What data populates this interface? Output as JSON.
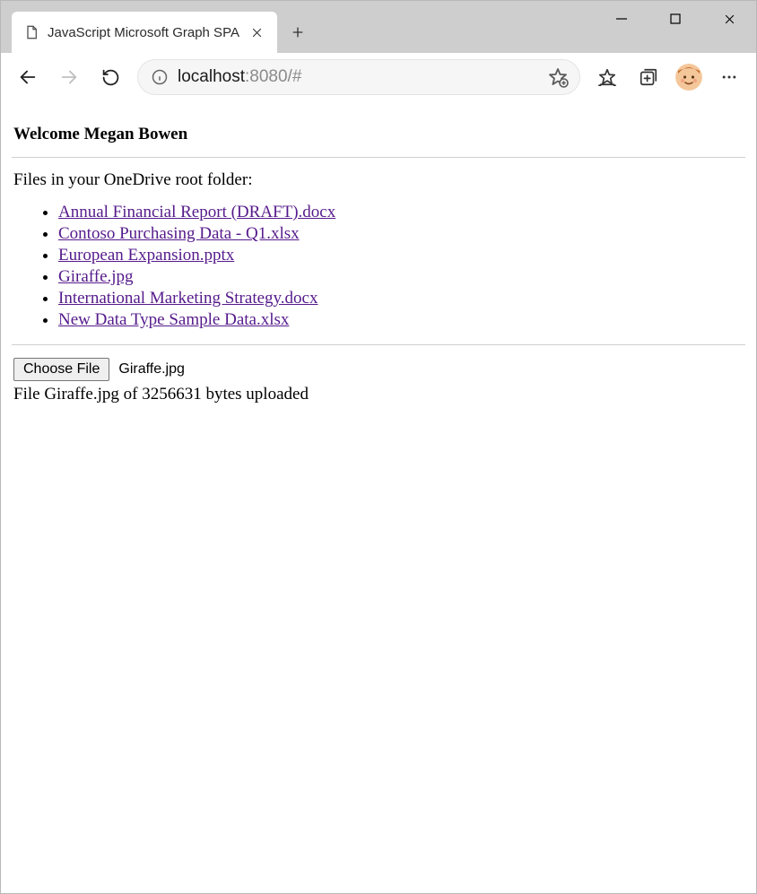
{
  "browser": {
    "tab_title": "JavaScript Microsoft Graph SPA",
    "url_host": "localhost",
    "url_path": ":8080/#"
  },
  "page": {
    "welcome_prefix": "Welcome ",
    "user_name": "Megan Bowen",
    "intro": "Files in your OneDrive root folder:",
    "files": [
      "Annual Financial Report (DRAFT).docx",
      "Contoso Purchasing Data - Q1.xlsx",
      "European Expansion.pptx",
      "Giraffe.jpg",
      "International Marketing Strategy.docx",
      "New Data Type Sample Data.xlsx"
    ],
    "choose_label": "Choose File",
    "chosen_file": "Giraffe.jpg",
    "upload_status_prefix": "File ",
    "upload_status_filename": "Giraffe.jpg",
    "upload_status_middle": " of ",
    "upload_status_bytes": "3256631",
    "upload_status_suffix": " bytes uploaded"
  }
}
